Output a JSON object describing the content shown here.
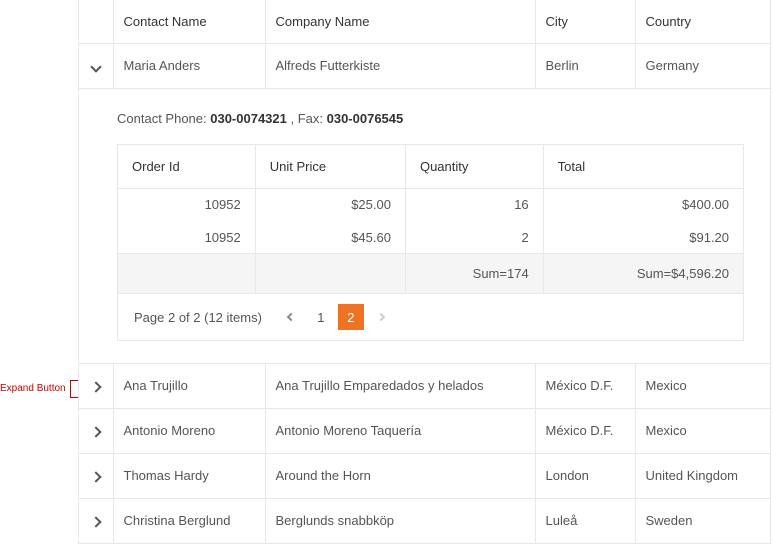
{
  "annotation": {
    "label": "Expand Button"
  },
  "columns": {
    "contact": "Contact Name",
    "company": "Company Name",
    "city": "City",
    "country": "Country"
  },
  "expanded_row": {
    "contact": "Maria Anders",
    "company": "Alfreds Futterkiste",
    "city": "Berlin",
    "country": "Germany",
    "detail": {
      "phone_label": "Contact Phone: ",
      "phone": "030-0074321",
      "fax_label": " , Fax: ",
      "fax": "030-0076545",
      "inner_columns": {
        "order_id": "Order Id",
        "unit_price": "Unit Price",
        "quantity": "Quantity",
        "total": "Total"
      },
      "rows": [
        {
          "order_id": "10952",
          "unit_price": "$25.00",
          "quantity": "16",
          "total": "$400.00"
        },
        {
          "order_id": "10952",
          "unit_price": "$45.60",
          "quantity": "2",
          "total": "$91.20"
        }
      ],
      "footer": {
        "quantity_sum": "Sum=174",
        "total_sum": "Sum=$4,596.20"
      },
      "pager": {
        "info": "Page 2 of 2 (12 items)",
        "page1": "1",
        "page2": "2"
      }
    }
  },
  "rows": [
    {
      "contact": "Ana Trujillo",
      "company": "Ana Trujillo Emparedados y helados",
      "city": "México D.F.",
      "country": "Mexico"
    },
    {
      "contact": "Antonio Moreno",
      "company": "Antonio Moreno Taquería",
      "city": "México D.F.",
      "country": "Mexico"
    },
    {
      "contact": "Thomas Hardy",
      "company": "Around the Horn",
      "city": "London",
      "country": "United Kingdom"
    },
    {
      "contact": "Christina Berglund",
      "company": "Berglunds snabbköp",
      "city": "Luleå",
      "country": "Sweden"
    }
  ]
}
